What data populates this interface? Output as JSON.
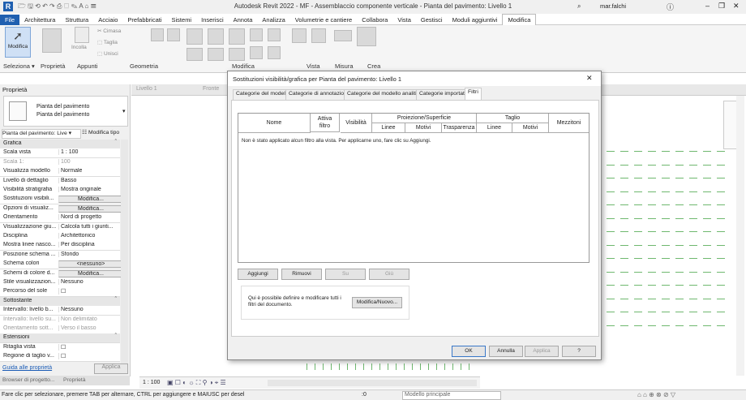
{
  "window": {
    "title": "Autodesk Revit 2022 - MF - Assemblaccio componente verticale - Pianta del pavimento: Livello 1",
    "user": "mar.falchi"
  },
  "ribbon": {
    "tabs": [
      "File",
      "Architettura",
      "Struttura",
      "Acciaio",
      "Prefabbricati",
      "Sistemi",
      "Inserisci",
      "Annota",
      "Analizza",
      "Volumetrie e cantiere",
      "Collabora",
      "Vista",
      "Gestisci",
      "Moduli aggiuntivi",
      "Modifica"
    ],
    "active_tab": "Modifica",
    "buttons": {
      "modifica": "Modifica",
      "incolla": "Incolla",
      "cimasa": "Cimasa",
      "taglia": "Taglia",
      "unisci": "Unisci"
    },
    "panels": [
      "Seleziona ▾",
      "Proprietà",
      "Appunti",
      "Geometria",
      "Modifica",
      "Vista",
      "Misura",
      "Crea"
    ]
  },
  "properties": {
    "header": "Proprietà",
    "type_line1": "Pianta del pavimento",
    "type_line2": "Pianta del pavimento",
    "instance": "Pianta del pavimento: Live",
    "edit_type": "Modifica tipo",
    "rows": [
      {
        "k": "Grafica",
        "v": "",
        "sec": true
      },
      {
        "k": "Scala vista",
        "v": "1 : 100"
      },
      {
        "k": "Scala  1:",
        "v": "100",
        "grey": true
      },
      {
        "k": "Visualizza modello",
        "v": "Normale"
      },
      {
        "k": "Livello di dettaglio",
        "v": "Basso"
      },
      {
        "k": "Visibilità stratigrafia",
        "v": "Mostra originale"
      },
      {
        "k": "Sostituzioni visibili...",
        "v": "Modifica...",
        "btn": true
      },
      {
        "k": "Opzioni di visualiz...",
        "v": "Modifica...",
        "btn": true
      },
      {
        "k": "Orientamento",
        "v": "Nord di progetto"
      },
      {
        "k": "Visualizzazione giu...",
        "v": "Calcola tutti i giunti..."
      },
      {
        "k": "Disciplina",
        "v": "Architettonico"
      },
      {
        "k": "Mostra linee nasco...",
        "v": "Per disciplina"
      },
      {
        "k": "Posizione schema ...",
        "v": "Sfondo"
      },
      {
        "k": "Schema colori",
        "v": "<nessuno>",
        "btn": true
      },
      {
        "k": "Schemi di colore d...",
        "v": "Modifica...",
        "btn": true
      },
      {
        "k": "Stile visualizzazion...",
        "v": "Nessuno"
      },
      {
        "k": "Percorso del sole",
        "v": "☐"
      },
      {
        "k": "Sottostante",
        "v": "",
        "sec": true
      },
      {
        "k": "Intervallo: livello b...",
        "v": "Nessuno"
      },
      {
        "k": "Intervallo: livello su...",
        "v": "Non delimitato",
        "grey": true
      },
      {
        "k": "Orientamento sott...",
        "v": "Verso il basso",
        "grey": true
      },
      {
        "k": "Estensioni",
        "v": "",
        "sec": true
      },
      {
        "k": "Ritaglia vista",
        "v": "☐"
      },
      {
        "k": "Regione di taglio v...",
        "v": "☐"
      }
    ],
    "help_link": "Guida alle proprietà",
    "apply": "Applica",
    "bottom_tabs": [
      "Browser di progetto...",
      "Proprietà"
    ]
  },
  "view_tabs": [
    "Livello 1",
    "Fronte"
  ],
  "dialog": {
    "title": "Sostituzioni visibilità/grafica per Pianta del pavimento: Livello 1",
    "tabs": [
      "Categorie del modello",
      "Categorie di annotazioni",
      "Categorie del modello analitico",
      "Categorie importate",
      "Filtri"
    ],
    "active_tab": "Filtri",
    "columns": {
      "nome": "Nome",
      "attiva": "Attiva\nfiltro",
      "visibilita": "Visibilità",
      "proiezione": "Proiezione/Superficie",
      "taglio": "Taglio",
      "mezzitoni": "Mezzitoni",
      "linee": "Linee",
      "motivi": "Motivi",
      "trasparenza": "Trasparenza",
      "linee2": "Linee",
      "motivi2": "Motivi"
    },
    "empty_message": "Non è stato applicato alcun filtro alla vista. Per applicarne uno, fare clic su Aggiungi.",
    "buttons": {
      "aggiungi": "Aggiungi",
      "rimuovi": "Rimuovi",
      "su": "Su",
      "giu": "Giù"
    },
    "info_text": "Qui è possibile definire e modificare tutti i filtri del documento.",
    "modify_new": "Modifica/Nuovo...",
    "footer": {
      "ok": "OK",
      "annulla": "Annulla",
      "applica": "Applica",
      "help": "?"
    }
  },
  "view_control": {
    "scale": "1 : 100"
  },
  "status": {
    "message": "Fare clic per selezionare, premere TAB per alternare, CTRL per aggiungere e MAIUSC per desel",
    "count": ":0",
    "model": "Modello principale"
  }
}
